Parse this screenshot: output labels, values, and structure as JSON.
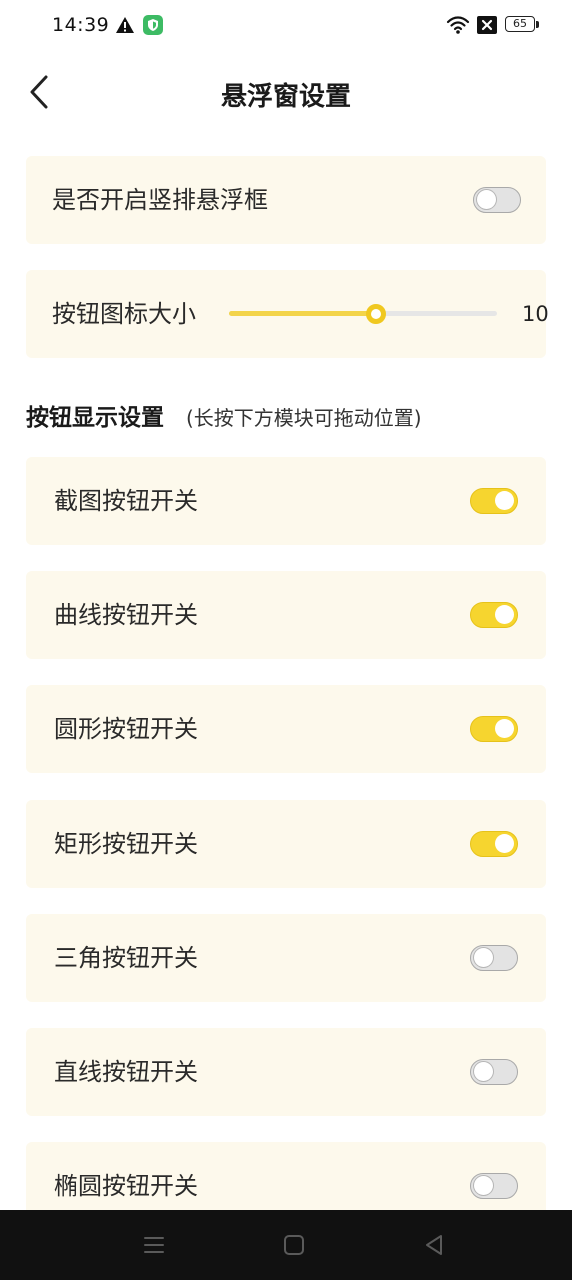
{
  "status_bar": {
    "time": "14:39",
    "battery_level": "65",
    "icons": [
      "warning-icon",
      "shield-icon",
      "wifi-icon",
      "no-sim-icon",
      "battery-icon"
    ]
  },
  "header": {
    "title": "悬浮窗设置",
    "back_icon": "chevron-left-icon"
  },
  "vertical_toggle": {
    "label": "是否开启竖排悬浮框",
    "on": false
  },
  "icon_size": {
    "label": "按钮图标大小",
    "value": "10",
    "fill_fraction": 0.55
  },
  "section": {
    "title": "按钮显示设置",
    "hint": "(长按下方模块可拖动位置)"
  },
  "buttons": [
    {
      "label": "截图按钮开关",
      "on": true
    },
    {
      "label": "曲线按钮开关",
      "on": true
    },
    {
      "label": "圆形按钮开关",
      "on": true
    },
    {
      "label": "矩形按钮开关",
      "on": true
    },
    {
      "label": "三角按钮开关",
      "on": false
    },
    {
      "label": "直线按钮开关",
      "on": false
    },
    {
      "label": "椭圆按钮开关",
      "on": false
    }
  ],
  "nav_bar": {
    "icons": [
      "menu-icon",
      "home-icon",
      "back-triangle-icon"
    ]
  },
  "colors": {
    "card_background": "#fdf9ec",
    "accent": "#f6d52f",
    "toggle_off": "#e3e3e3"
  }
}
